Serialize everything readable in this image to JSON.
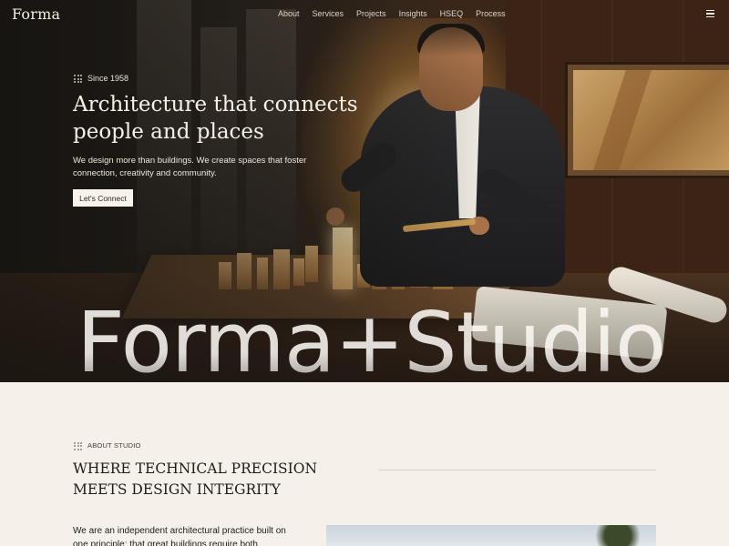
{
  "nav": {
    "logo": "Forma",
    "links": [
      "About",
      "Services",
      "Projects",
      "Insights",
      "HSEQ",
      "Process"
    ]
  },
  "hero": {
    "eyebrow": "Since 1958",
    "title": "Architecture that connects people and places",
    "subtitle": "We design more than buildings. We create spaces that foster connection, creativity and community.",
    "cta_label": "Let's Connect",
    "big_word": "Forma+Studio"
  },
  "about": {
    "eyebrow": "ABOUT STUDIO",
    "title": "WHERE TECHNICAL PRECISION MEETS DESIGN INTEGRITY",
    "body": "We are an independent architectural practice built on one principle: that great buildings require both"
  },
  "colors": {
    "page_background": "#f5f1ea",
    "hero_text": "#f6f1e8",
    "accent_button": "#f7f3ec"
  },
  "icons": {
    "menu": "hamburger-menu-icon",
    "eyebrow": "dot-grid-icon"
  }
}
